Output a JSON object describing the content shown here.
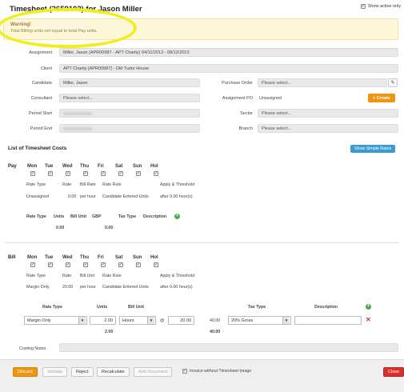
{
  "header": {
    "title": "Timesheet (2659102) for Jason Miller",
    "show_active_label": "Show active only"
  },
  "warning": {
    "title": "Warning!",
    "message": "Total Billing units not equal to total Pay units."
  },
  "form": {
    "assignment_label": "Assignment",
    "assignment_value": "Miller, Jason (APR00987 - APT Charity) 04/11/2013 - 08/12/2013",
    "client_label": "Client",
    "client_value": "APT Charity [APR00987] - Old Tudor House",
    "candidate_label": "Candidate",
    "candidate_value": "Miller, Jason",
    "consultant_label": "Consultant",
    "consultant_placeholder": "Please select...",
    "period_start_label": "Period Start",
    "period_end_label": "Period End",
    "purchase_order_label": "Purchase Order",
    "purchase_order_placeholder": "Please select...",
    "assignment_po_label": "Assignment PO",
    "assignment_po_value": "Unassigned",
    "create_label": "+ Create",
    "sector_label": "Sector",
    "sector_placeholder": "Please select...",
    "branch_label": "Branch",
    "branch_placeholder": "Please select..."
  },
  "costs": {
    "title": "List of Timesheet Costs",
    "show_simple_rates_label": "Show Simple Rates",
    "days": [
      "Mon",
      "Tue",
      "Wed",
      "Thu",
      "Fri",
      "Sat",
      "Sun",
      "Hol"
    ],
    "pay": {
      "label": "Pay",
      "row_headers": [
        "Rate Type",
        "Rate",
        "Bill Rate",
        "Rate Rule",
        "Apply & Threshold"
      ],
      "row_values": [
        "Unassigned",
        "0.00",
        "per hour",
        "Candidate Entered Units",
        "after 0.00 hour(s)"
      ],
      "summary_headers": [
        "Rate Type",
        "Units",
        "Bill Unit",
        "GBP",
        "Tax Type",
        "Description"
      ],
      "summary_units": "0.00",
      "summary_gbp": "0.00"
    },
    "bill": {
      "label": "Bill",
      "row_headers": [
        "Rate Type",
        "Rate",
        "Bill Unit",
        "Rate Rule",
        "Apply & Threshold"
      ],
      "row_values": [
        "Margin Only",
        "20.00",
        "per hour",
        "Candidate Entered Units",
        "after 0.00 hour(s)"
      ],
      "summary_headers": [
        "Rate Type",
        "Units",
        "Bill Unit",
        "Tax Type",
        "Description"
      ],
      "line": {
        "rate_type": "Margin Only",
        "units": "2.00",
        "bill_unit": "Hours",
        "at": "@",
        "rate": "20.00",
        "amount": "40.00",
        "tax_type": "20% Gross",
        "description": ""
      },
      "total_units": "2.00",
      "total_amount": "40.00"
    },
    "costing_notes_label": "Costing Notes"
  },
  "footer": {
    "buttons": [
      "Discard",
      "Validate",
      "Reject",
      "Recalculate",
      "Add Document"
    ],
    "invoice_label": "Invoice without Timesheet Image",
    "close_label": "Close"
  },
  "colors": {
    "accent_orange": "#f0950e",
    "accent_blue": "#3a9bd1",
    "danger_red": "#d9302c",
    "warning_bg": "#fcf7d9",
    "highlight_yellow": "#f1ee1a"
  }
}
